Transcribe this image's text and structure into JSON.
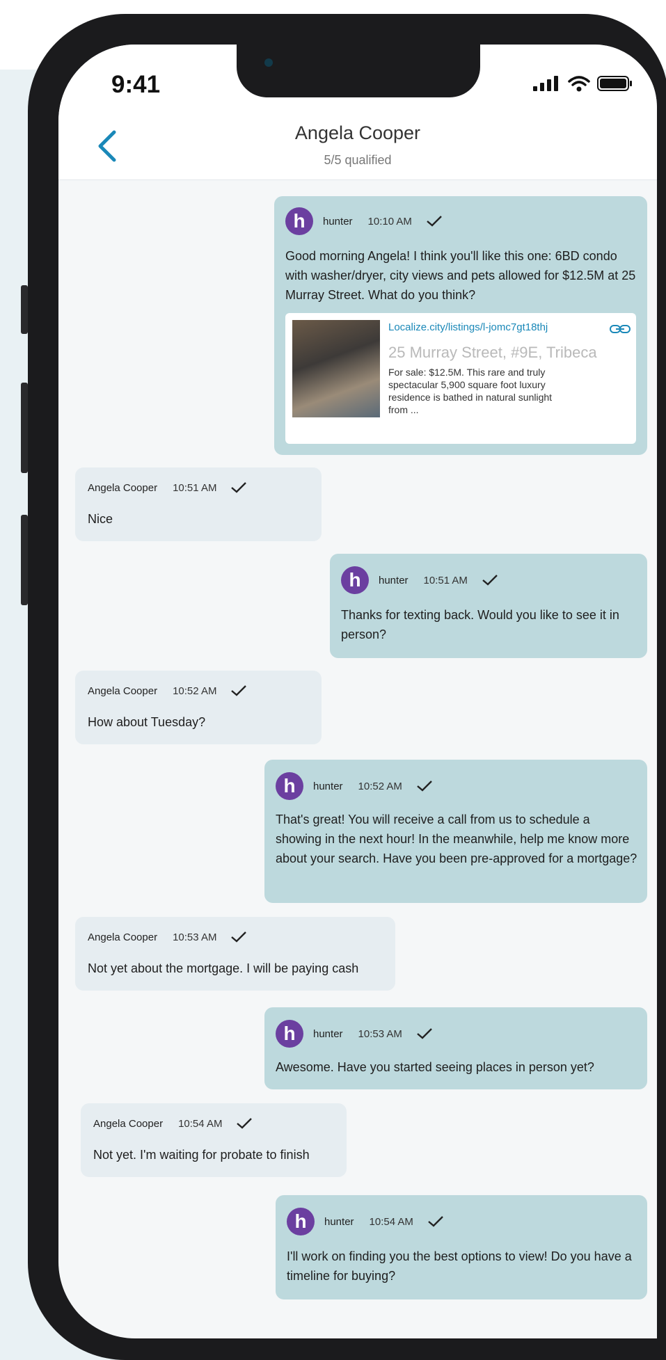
{
  "status_bar": {
    "time": "9:41"
  },
  "header": {
    "contact_name": "Angela Cooper",
    "subtitle": "5/5 qualified"
  },
  "colors": {
    "accent": "#1a88b8",
    "outgoing_bubble": "#bdd9dd",
    "incoming_bubble": "#e6edf1",
    "avatar": "#6b3fa0"
  },
  "icons": [
    "back-chevron-icon",
    "signal-icon",
    "wifi-icon",
    "battery-icon",
    "checkmark-icon",
    "link-icon"
  ],
  "messages": [
    {
      "sender": "hunter",
      "avatar": "h",
      "time": "10:10 AM",
      "text": "Good morning Angela! I think you'll like this one: 6BD condo with washer/dryer, city views and pets allowed for $12.5M at 25 Murray Street. What do you think?",
      "link_card": {
        "url": "Localize.city/listings/l-jomc7gt18thj",
        "address": "25 Murray Street, #9E, Tribeca",
        "description": "For sale: $12.5M. This rare and truly spectacular 5,900 square foot luxury residence is bathed in natural sunlight from ..."
      }
    },
    {
      "sender": "Angela Cooper",
      "time": "10:51 AM",
      "text": "Nice"
    },
    {
      "sender": "hunter",
      "avatar": "h",
      "time": "10:51 AM",
      "text": "Thanks for texting back. Would you like to see it in person?"
    },
    {
      "sender": "Angela Cooper",
      "time": "10:52 AM",
      "text": "How about Tuesday?"
    },
    {
      "sender": "hunter",
      "avatar": "h",
      "time": "10:52 AM",
      "text": "That's great! You will receive a call from us to schedule a showing in the next hour! In the meanwhile, help me know more about your search. Have you been pre-approved for a mortgage?"
    },
    {
      "sender": "Angela Cooper",
      "time": "10:53 AM",
      "text": "Not yet about the mortgage. I will be paying cash"
    },
    {
      "sender": "hunter",
      "avatar": "h",
      "time": "10:53 AM",
      "text": "Awesome. Have you started seeing places in person yet?"
    },
    {
      "sender": "Angela Cooper",
      "time": "10:54 AM",
      "text": "Not yet. I'm waiting for probate to finish"
    },
    {
      "sender": "hunter",
      "avatar": "h",
      "time": "10:54 AM",
      "text": "I'll work on finding you the best options to view! Do you have a timeline for buying?"
    }
  ]
}
